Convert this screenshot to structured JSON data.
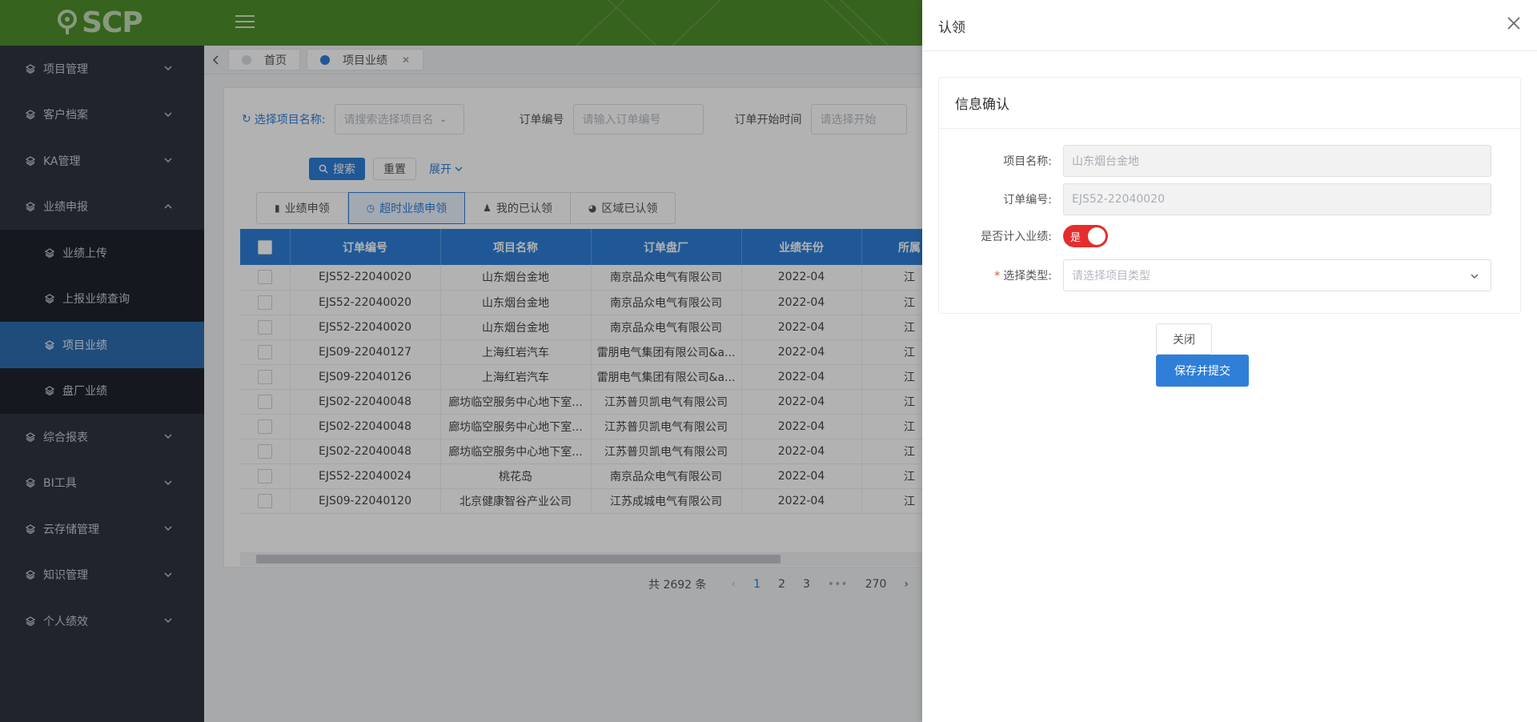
{
  "header": {
    "logo_text": "SCP"
  },
  "sidebar": {
    "items": [
      {
        "label": "项目管理"
      },
      {
        "label": "客户档案"
      },
      {
        "label": "KA管理"
      },
      {
        "label": "业绩申报"
      },
      {
        "label": "综合报表"
      },
      {
        "label": "BI工具"
      },
      {
        "label": "云存储管理"
      },
      {
        "label": "知识管理"
      },
      {
        "label": "个人绩效"
      }
    ],
    "sub_items": [
      {
        "label": "业绩上传"
      },
      {
        "label": "上报业绩查询"
      },
      {
        "label": "项目业绩"
      },
      {
        "label": "盘厂业绩"
      }
    ]
  },
  "tabs": [
    {
      "label": "首页"
    },
    {
      "label": "项目业绩"
    }
  ],
  "filters": {
    "project_label": "选择项目名称:",
    "project_placeholder": "请搜索选择项目名",
    "order_label": "订单编号",
    "order_placeholder": "请输入订单编号",
    "start_label": "订单开始时间",
    "start_placeholder": "请选择开始"
  },
  "buttons": {
    "search": "搜索",
    "reset": "重置",
    "expand": "展开"
  },
  "subtabs": [
    {
      "label": "业绩申领"
    },
    {
      "label": "超时业绩申领"
    },
    {
      "label": "我的已认领"
    },
    {
      "label": "区域已认领"
    }
  ],
  "table": {
    "columns": [
      "订单编号",
      "项目名称",
      "订单盘厂",
      "业绩年份",
      "所属"
    ],
    "rows": [
      [
        "EJS52-22040020",
        "山东烟台金地",
        "南京品众电气有限公司",
        "2022-04",
        "江"
      ],
      [
        "EJS52-22040020",
        "山东烟台金地",
        "南京品众电气有限公司",
        "2022-04",
        "江"
      ],
      [
        "EJS52-22040020",
        "山东烟台金地",
        "南京品众电气有限公司",
        "2022-04",
        "江"
      ],
      [
        "EJS09-22040127",
        "上海红岩汽车",
        "雷朋电气集团有限公司&a...",
        "2022-04",
        "江"
      ],
      [
        "EJS09-22040126",
        "上海红岩汽车",
        "雷朋电气集团有限公司&a...",
        "2022-04",
        "江"
      ],
      [
        "EJS02-22040048",
        "廊坊临空服务中心地下室...",
        "江苏普贝凯电气有限公司",
        "2022-04",
        "江"
      ],
      [
        "EJS02-22040048",
        "廊坊临空服务中心地下室...",
        "江苏普贝凯电气有限公司",
        "2022-04",
        "江"
      ],
      [
        "EJS02-22040048",
        "廊坊临空服务中心地下室...",
        "江苏普贝凯电气有限公司",
        "2022-04",
        "江"
      ],
      [
        "EJS52-22040024",
        "桃花岛",
        "南京品众电气有限公司",
        "2022-04",
        "江"
      ],
      [
        "EJS09-22040120",
        "北京健康智谷产业公司",
        "江苏成城电气有限公司",
        "2022-04",
        "江"
      ]
    ]
  },
  "pager": {
    "total": "共 2692 条",
    "pages": [
      "1",
      "2",
      "3",
      "•••",
      "270"
    ]
  },
  "drawer": {
    "title": "认领",
    "card_title": "信息确认",
    "fields": {
      "project_label": "项目名称:",
      "project_value": "山东烟台金地",
      "order_label": "订单编号:",
      "order_value": "EJS52-22040020",
      "count_label": "是否计入业绩:",
      "count_switch_text": "是",
      "type_label": "选择类型:",
      "type_placeholder": "请选择项目类型"
    },
    "close_button": "关闭",
    "submit_button": "保存并提交"
  },
  "colors": {
    "primary": "#2f7fd8",
    "header": "#4e8e2c",
    "sidebar": "#2e3440",
    "switch_on": "#e52d2d"
  }
}
